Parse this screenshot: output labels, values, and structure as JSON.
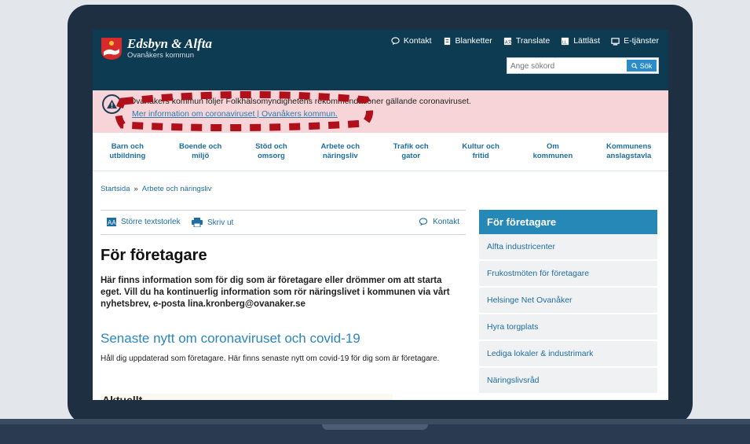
{
  "header": {
    "site_name": "Edsbyn & Alfta",
    "site_sub": "Ovanåkers kommun",
    "nav": [
      {
        "label": "Kontakt",
        "icon": "speech-bubble-icon"
      },
      {
        "label": "Blanketter",
        "icon": "document-icon"
      },
      {
        "label": "Translate",
        "icon": "translate-icon"
      },
      {
        "label": "Lättläst",
        "icon": "easy-read-icon"
      },
      {
        "label": "E-tjänster",
        "icon": "monitor-icon"
      }
    ],
    "search_placeholder": "Ange sökord",
    "search_button": "Sök"
  },
  "alert": {
    "text": "Ovanåkers kommun följer Folkhälsomyndighetens rekommendationer gällande coronaviruset.",
    "link": "Mer information om coronaviruset | Ovanåkers kommun."
  },
  "mainnav": [
    "Barn och\nutbildning",
    "Boende och\nmiljö",
    "Stöd och\nomsorg",
    "Arbete och\nnäringsliv",
    "Trafik och\ngator",
    "Kultur och\nfritid",
    "Om\nkommunen",
    "Kommunens\nanslagstavla"
  ],
  "breadcrumb": {
    "home": "Startsida",
    "sep": "»",
    "current": "Arbete och näringsliv"
  },
  "toolbar": {
    "text_size": "Större textstorlek",
    "print": "Skriv ut",
    "contact": "Kontakt"
  },
  "content": {
    "title": "För företagare",
    "intro": "Här finns information som för dig som är företagare eller drömmer om att starta eget. Vill du ha kontinuerlig information som rör näringslivet i kommunen via vårt nyhetsbrev, e-posta lina.kronberg@ovanaker.se",
    "news_title": "Senaste nytt om coronaviruset och covid-19",
    "news_text": "Håll dig uppdaterad som företagare. Här finns senaste nytt om covid-19 för dig som är företagare.",
    "aktuellt": "Aktuellt"
  },
  "sidebar": {
    "title": "För företagare",
    "items": [
      "Alfta industricenter",
      "Frukostmöten för företagare",
      "Helsinge Net Ovanåker",
      "Hyra torgplats",
      "Lediga lokaler & industrimark",
      "Näringslivsråd"
    ]
  },
  "colors": {
    "header": "#0d3b52",
    "alert": "#f7d4d7",
    "accent": "#2588b7",
    "dash": "#b0101a"
  }
}
